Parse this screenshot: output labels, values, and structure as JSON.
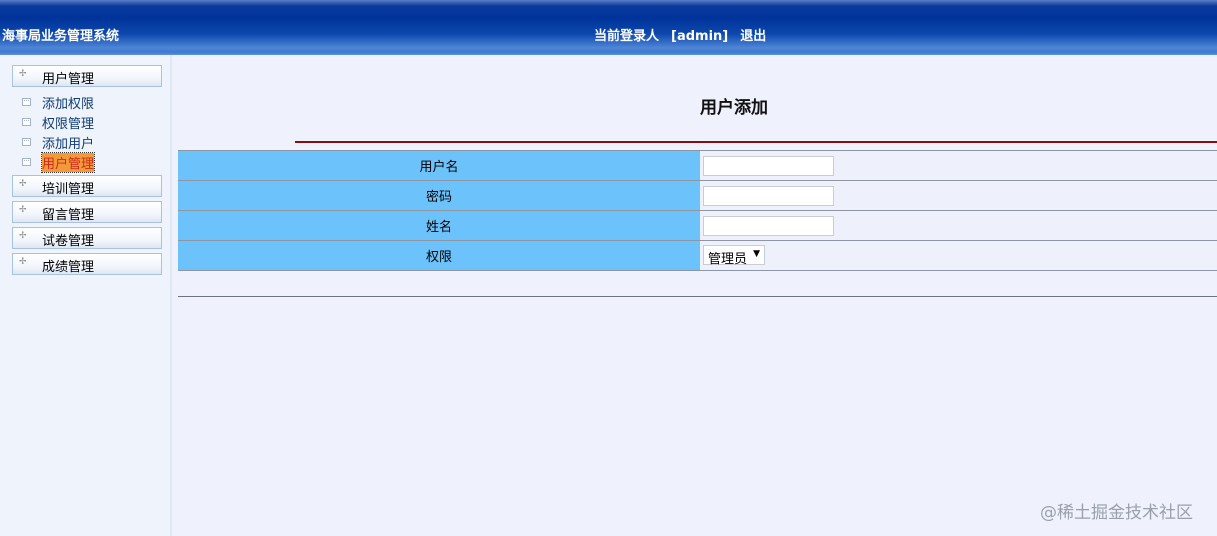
{
  "header": {
    "system_title": "海事局业务管理系统",
    "login_label": "当前登录人",
    "username": "[admin]",
    "logout": "退出"
  },
  "sidebar": {
    "groups": [
      {
        "label": "用户管理"
      },
      {
        "label": "培训管理"
      },
      {
        "label": "留言管理"
      },
      {
        "label": "试卷管理"
      },
      {
        "label": "成绩管理"
      }
    ],
    "sub_items": [
      {
        "label": "添加权限"
      },
      {
        "label": "权限管理"
      },
      {
        "label": "添加用户"
      },
      {
        "label": "用户管理",
        "active": true
      }
    ]
  },
  "main": {
    "title": "用户添加",
    "fields": [
      {
        "label": "用户名",
        "value": ""
      },
      {
        "label": "密码",
        "value": ""
      },
      {
        "label": "姓名",
        "value": ""
      },
      {
        "label": "权限",
        "selected": "管理员"
      }
    ]
  },
  "watermark": "@稀土掘金技术社区"
}
